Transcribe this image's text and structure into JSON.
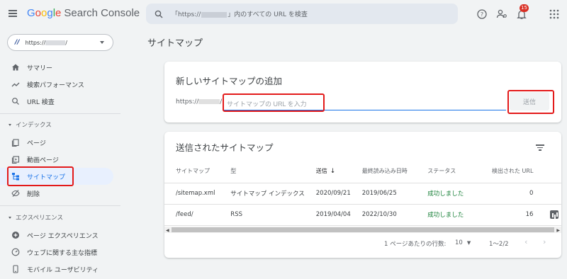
{
  "header": {
    "logo_google": [
      "G",
      "o",
      "o",
      "g",
      "l",
      "e"
    ],
    "logo_product": "Search Console",
    "search_prefix": "「https://",
    "search_suffix": "」内のすべての URL を検査",
    "notification_count": "15",
    "icons": [
      "menu-icon",
      "search-icon",
      "help-icon",
      "manage-users-icon",
      "bell-icon",
      "apps-icon"
    ]
  },
  "sidebar": {
    "property_url_prefix": "https://",
    "property_url_suffix": "/",
    "items_top": [
      {
        "label": "サマリー",
        "icon": "home-icon"
      },
      {
        "label": "検索パフォーマンス",
        "icon": "trending-icon"
      },
      {
        "label": "URL 検査",
        "icon": "search-icon"
      }
    ],
    "section_index": "インデックス",
    "items_index": [
      {
        "label": "ページ",
        "icon": "pages-icon"
      },
      {
        "label": "動画ページ",
        "icon": "video-pages-icon"
      },
      {
        "label": "サイトマップ",
        "icon": "sitemap-icon",
        "active": true
      },
      {
        "label": "削除",
        "icon": "removals-icon"
      }
    ],
    "section_experience": "エクスペリエンス",
    "items_experience": [
      {
        "label": "ページ エクスペリエンス",
        "icon": "plus-circle-icon"
      },
      {
        "label": "ウェブに関する主な指標",
        "icon": "gauge-icon"
      },
      {
        "label": "モバイル ユーザビリティ",
        "icon": "mobile-icon"
      }
    ]
  },
  "main": {
    "page_title": "サイトマップ",
    "add_card": {
      "title": "新しいサイトマップの追加",
      "prefix": "https://",
      "prefix_end": "/",
      "placeholder": "サイトマップの URL を入力",
      "submit_label": "送信"
    },
    "submitted_card": {
      "title": "送信されたサイトマップ",
      "columns": [
        "サイトマップ",
        "型",
        "送信",
        "最終読み込み日時",
        "ステータス",
        "検出された URL"
      ],
      "rows": [
        {
          "sitemap": "/sitemap.xml",
          "type": "サイトマップ インデックス",
          "submitted": "2020/09/21",
          "last_read": "2019/06/25",
          "status": "成功しました",
          "urls": "0"
        },
        {
          "sitemap": "/feed/",
          "type": "RSS",
          "submitted": "2019/04/04",
          "last_read": "2022/10/30",
          "status": "成功しました",
          "urls": "16"
        }
      ],
      "rows_per_page_label": "1 ページあたりの行数:",
      "rows_per_page_value": "10",
      "range": "1〜2/2"
    }
  },
  "colors": {
    "accent": "#1a73e8",
    "success": "#188038",
    "highlight_box": "#e31a1a",
    "active_nav_bg": "#e8f0fe"
  }
}
